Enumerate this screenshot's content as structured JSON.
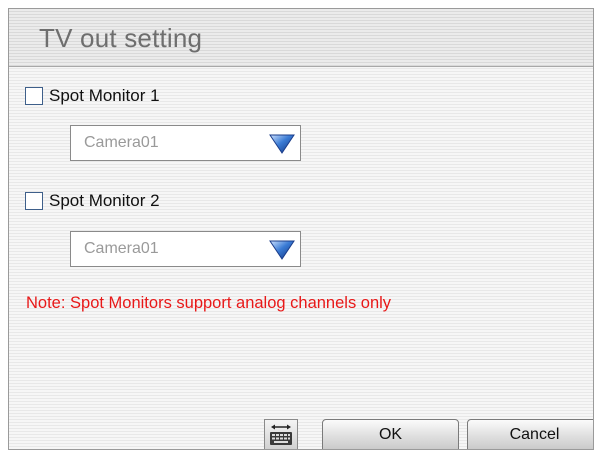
{
  "dialog": {
    "title": "TV out setting"
  },
  "spot_monitor_1": {
    "label": "Spot Monitor 1",
    "checked": false,
    "camera_value": "Camera01"
  },
  "spot_monitor_2": {
    "label": "Spot Monitor 2",
    "checked": false,
    "camera_value": "Camera01"
  },
  "note": "Note: Spot Monitors support analog channels only",
  "buttons": {
    "ok_label": "OK",
    "cancel_label": "Cancel"
  },
  "icons": {
    "dropdown_arrow": "triangle-down-icon",
    "keyboard": "keyboard-icon"
  },
  "colors": {
    "note_text": "#e81818",
    "title_text": "#6e6e6e",
    "checkbox_border": "#3e5f8a",
    "dropdown_arrow": "#3a7bd5"
  }
}
